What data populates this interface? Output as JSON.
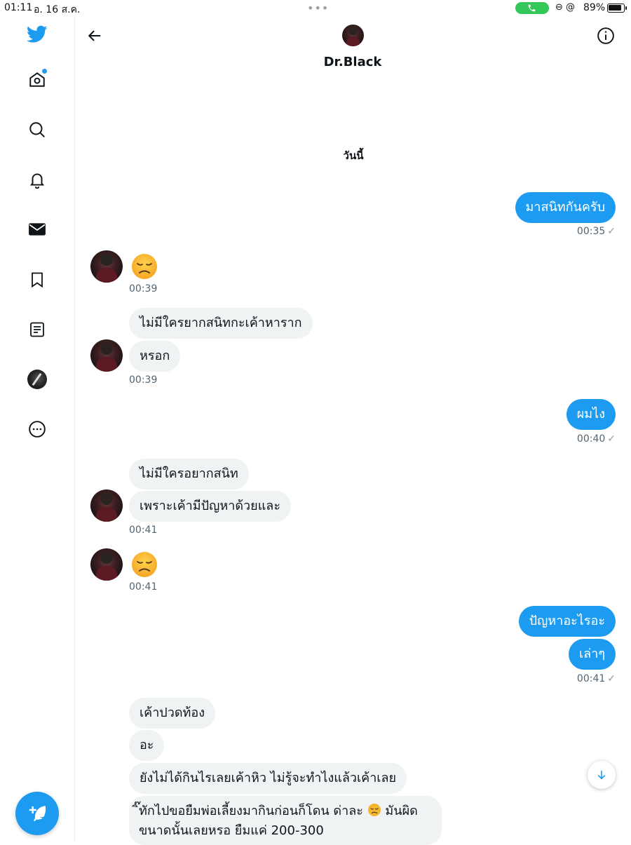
{
  "status_bar": {
    "time": "01:11",
    "date": "อ. 16 ส.ค.",
    "multitask_dots": "•••",
    "extra_icons": "⊖ @",
    "battery_percent": "89%",
    "battery_level": 0.89,
    "call_color": "#34c759"
  },
  "sidebar": {
    "items": [
      {
        "icon": "home-icon",
        "has_notification_dot": true
      },
      {
        "icon": "search-icon"
      },
      {
        "icon": "bell-icon"
      },
      {
        "icon": "mail-icon",
        "active": true
      },
      {
        "icon": "bookmark-icon"
      },
      {
        "icon": "list-icon"
      },
      {
        "icon": "profile-avatar"
      },
      {
        "icon": "more-icon"
      }
    ],
    "brand_color": "#1d9bf0"
  },
  "header": {
    "name": "Dr.Black"
  },
  "conversation": {
    "date_separator": "วันนี้",
    "messages": [
      {
        "direction": "out",
        "text": "มาสนิทกันครับ",
        "time": "00:35",
        "check": "✓"
      },
      {
        "direction": "in",
        "emoji": "disappointed-face",
        "time": "00:39"
      },
      {
        "direction": "in",
        "text": "ไม่มีใครยากสนิทกะเค้าหาราก"
      },
      {
        "direction": "in",
        "text": "หรอก",
        "time": "00:39"
      },
      {
        "direction": "out",
        "text": "ผมไง",
        "time": "00:40",
        "check": "✓"
      },
      {
        "direction": "in",
        "text": "ไม่มีใครอยากสนิท"
      },
      {
        "direction": "in",
        "text": "เพราะเค้ามีปัญหาด้วยและ",
        "time": "00:41"
      },
      {
        "direction": "in",
        "emoji": "disappointed-face",
        "time": "00:41"
      },
      {
        "direction": "out",
        "text": "ปัญหาอะไรอะ"
      },
      {
        "direction": "out",
        "text": "เล่าๆ",
        "time": "00:41",
        "check": "✓"
      },
      {
        "direction": "in",
        "text": "เค้าปวดท้อง"
      },
      {
        "direction": "in",
        "text": "อะ"
      },
      {
        "direction": "in",
        "text": "ยังไม่ได้กินไรเลยเค้าหิว ไม่รู้จะทำไงแล้วเค้าเลย"
      },
      {
        "direction": "in",
        "text_line1_a": "ิ๊ทักไปขอยืมพ่อเลี้ยงมากินก่อนก็โดน ด่าละ",
        "text_line1_b": "มันผิด",
        "text_line2": "ขนาดนั้นเลยหรอ ยืมแค่ 200-300"
      }
    ]
  }
}
